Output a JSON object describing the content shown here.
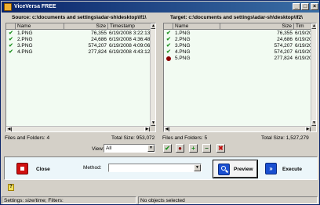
{
  "window": {
    "title": "ViceVersa FREE",
    "controls": {
      "minimize": "_",
      "maximize": "□",
      "close": "×"
    }
  },
  "source": {
    "header": "Source: c:\\documents and settings\\adar-sh\\desktop\\lf1\\",
    "columns": [
      "Name",
      "Size",
      "Timestamp"
    ],
    "rows": [
      {
        "status": "check-icon",
        "name": "1.PNG",
        "size": "76,355",
        "timestamp": "6/19/2008 3:22:13 ..."
      },
      {
        "status": "check-icon",
        "name": "2.PNG",
        "size": "24,686",
        "timestamp": "6/19/2008 4:36:48 ..."
      },
      {
        "status": "check-icon",
        "name": "3.PNG",
        "size": "574,207",
        "timestamp": "6/19/2008 4:09:06 ..."
      },
      {
        "status": "check-icon",
        "name": "4.PNG",
        "size": "277,824",
        "timestamp": "6/19/2008 4:43:12 ..."
      }
    ],
    "files_and_folders": "Files and Folders: 4",
    "total_size": "Total Size: 953,072"
  },
  "target": {
    "header": "Target: c:\\documents and settings\\adar-sh\\desktop\\lf2\\",
    "columns": [
      "Name",
      "Size",
      "Tim"
    ],
    "rows": [
      {
        "status": "check-icon",
        "name": "1.PNG",
        "size": "76,355",
        "timestamp": "6/19/200"
      },
      {
        "status": "check-icon",
        "name": "2.PNG",
        "size": "24,686",
        "timestamp": "6/19/200"
      },
      {
        "status": "check-icon",
        "name": "3.PNG",
        "size": "574,207",
        "timestamp": "6/19/200"
      },
      {
        "status": "check-icon",
        "name": "4.PNG",
        "size": "574,207",
        "timestamp": "6/19/200"
      },
      {
        "status": "red-dot-icon",
        "name": "5.PNG",
        "size": "277,824",
        "timestamp": "6/19/200"
      }
    ],
    "files_and_folders": "Files and Folders: 5",
    "total_size": "Total Size: 1,527,279"
  },
  "view": {
    "label": "View:",
    "selected": "All"
  },
  "toolbar": {
    "check": "✔",
    "dot": "●",
    "plus": "+",
    "minus": "−",
    "delete": "✖"
  },
  "actions": {
    "close_label": "Close",
    "method_label": "Method:",
    "method_value": "",
    "preview_label": "Preview",
    "execute_label": "Execute"
  },
  "help": {
    "glyph": "?"
  },
  "status": {
    "settings": "Settings: size/time; Filters:",
    "selection": "No objects selected"
  },
  "colors": {
    "title_bar": "#0a246a",
    "list_bg": "#f2fbf2",
    "check": "#1e9020",
    "red_dot": "#8b0000",
    "close_icon": "#d01010",
    "preview_icon": "#1a4fd0",
    "execute_icon": "#1a4fd0"
  }
}
